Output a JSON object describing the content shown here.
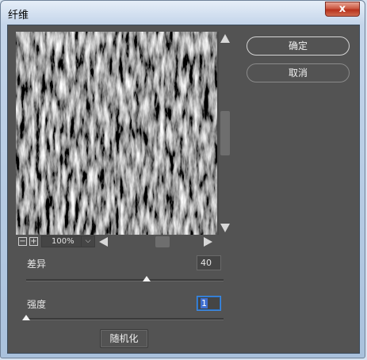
{
  "window": {
    "title": "纤维",
    "close_glyph": "x"
  },
  "buttons": {
    "ok": "确定",
    "cancel": "取消",
    "randomize": "随机化"
  },
  "preview": {
    "zoom_level": "100%",
    "zoom_out_glyph": "−",
    "zoom_in_glyph": "+",
    "dropdown_glyph": "⌵"
  },
  "controls": {
    "variance": {
      "label": "差异",
      "value": "40",
      "level": 0.61
    },
    "strength": {
      "label": "强度",
      "value": "1",
      "level": 0.0
    }
  },
  "colors": {
    "dialog_bg": "#535353",
    "focus_blue": "#3c8ce7",
    "close_red": "#c44a34"
  }
}
